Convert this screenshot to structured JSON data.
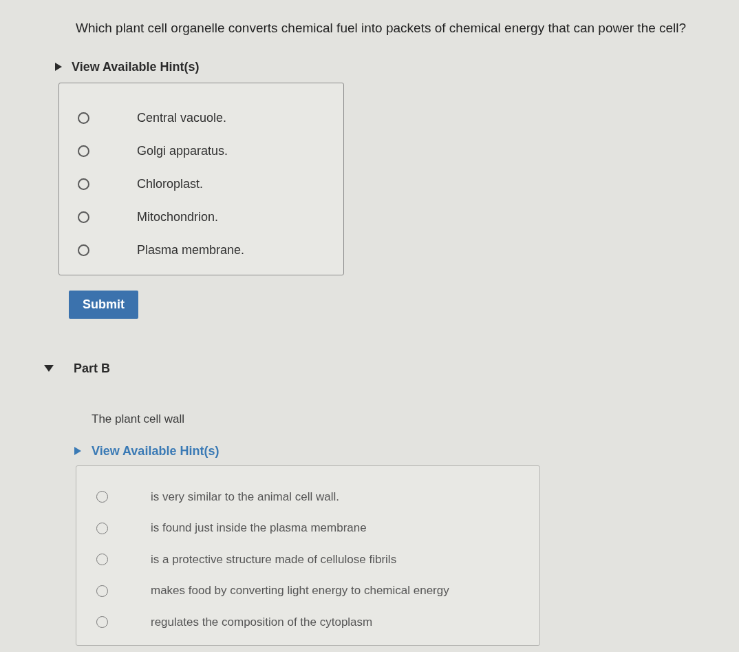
{
  "part_a": {
    "question": "Which plant cell organelle converts chemical fuel into packets of chemical energy that can power the cell?",
    "hint_toggle": {
      "label": "View Available Hint(s)",
      "expanded": false
    },
    "options": [
      {
        "label": "Central vacuole.",
        "selected": false
      },
      {
        "label": "Golgi apparatus.",
        "selected": false
      },
      {
        "label": "Chloroplast.",
        "selected": false
      },
      {
        "label": "Mitochondrion.",
        "selected": false
      },
      {
        "label": "Plasma membrane.",
        "selected": false
      }
    ],
    "submit_button": "Submit"
  },
  "part_b": {
    "heading": "Part B",
    "expanded": true,
    "prompt": "The plant cell wall",
    "hint_toggle": {
      "label": "View Available Hint(s)",
      "expanded": false
    },
    "options": [
      {
        "label": "is very similar to the animal cell wall.",
        "selected": false
      },
      {
        "label": "is found just inside the plasma membrane",
        "selected": false
      },
      {
        "label": "is a protective structure made of cellulose fibrils",
        "selected": false
      },
      {
        "label": "makes food by converting light energy to chemical energy",
        "selected": false
      },
      {
        "label": "regulates the composition of the cytoplasm",
        "selected": false
      }
    ]
  }
}
